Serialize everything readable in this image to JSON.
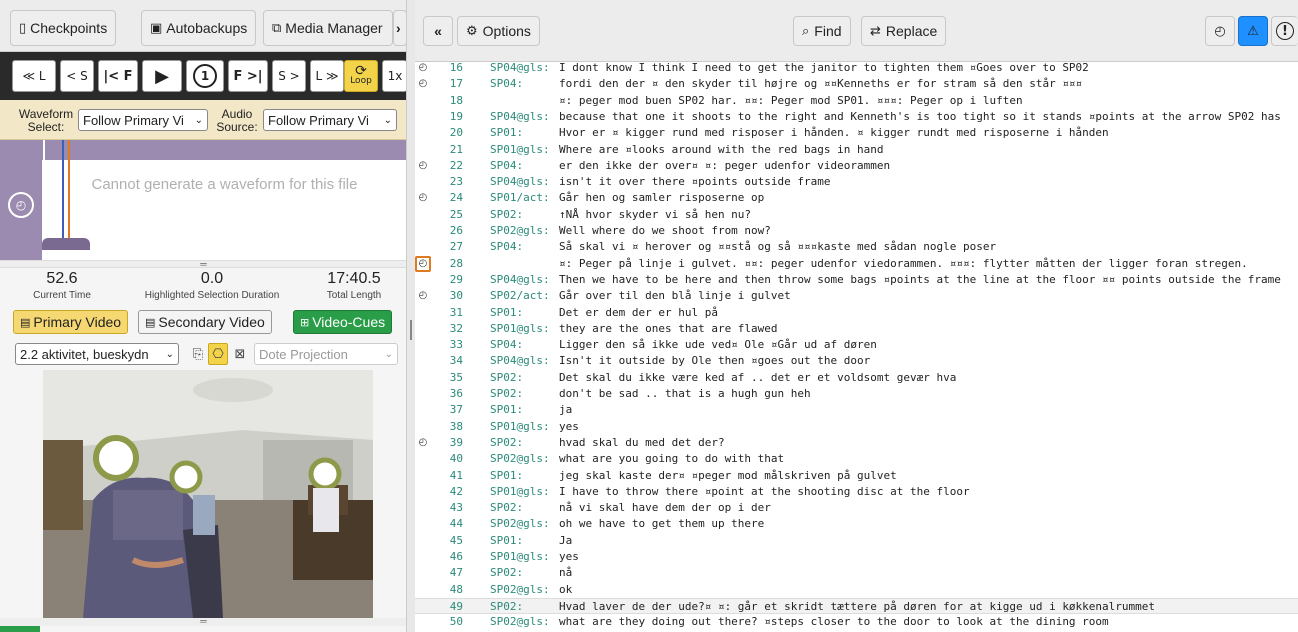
{
  "left": {
    "toolbar": {
      "checkpoints_label": "Checkpoints",
      "autobackups_label": "Autobackups",
      "media_manager_label": "Media Manager",
      "overflow_label": "›"
    },
    "controls": {
      "prev_line": "≪ L",
      "prev_segment": "< S",
      "prev_frame": "|< F",
      "play": "▶",
      "replay": "1",
      "next_frame": "F >|",
      "next_segment": "S >",
      "next_line": "L ≫",
      "loop_label": "Loop",
      "speed": "1x"
    },
    "waveform_select": {
      "waveform_label": "Waveform Select:",
      "waveform_value": "Follow Primary Vi",
      "audio_label": "Audio Source:",
      "audio_value": "Follow Primary Vi"
    },
    "waveform_message": "Cannot generate a waveform for this file",
    "stats": {
      "current_time": "52.6",
      "current_time_label": "Current Time",
      "selection_duration": "0.0",
      "selection_duration_label": "Highlighted Selection Duration",
      "total_length": "17:40.5",
      "total_length_label": "Total Length"
    },
    "video_tabs": {
      "primary": "Primary Video",
      "secondary": "Secondary Video",
      "cues": "Video-Cues"
    },
    "segment_select": {
      "value": "2.2 aktivitet, bueskydn",
      "projection_placeholder": "Dote Projection"
    }
  },
  "right": {
    "toolbar": {
      "collapse_label": "«",
      "options_label": "Options",
      "find_label": "Find",
      "replace_label": "Replace"
    },
    "colors": {
      "warning_active": "#1e90ff",
      "line_number": "#2a8a7a",
      "speaker": "#2a8a7a"
    },
    "lines": [
      {
        "n": "16",
        "spk": "SP04@gls:",
        "txt": "I dont know I think I need to get the janitor to tighten them ¤Goes over to SP02",
        "icon": "clock"
      },
      {
        "n": "17",
        "spk": "SP04:",
        "txt": "fordi den der ¤ den skyder til højre og ¤¤Kenneths er for stram så den står ¤¤¤",
        "icon": "clock"
      },
      {
        "n": "18",
        "spk": "",
        "txt": "¤: peger mod buen SP02 har. ¤¤: Peger mod SP01. ¤¤¤: Peger op i luften",
        "icon": ""
      },
      {
        "n": "19",
        "spk": "SP04@gls:",
        "txt": "because that one it shoots to the right and Kenneth's is too tight so it stands ¤points at the arrow SP02 has",
        "icon": ""
      },
      {
        "n": "20",
        "spk": "SP01:",
        "txt": "Hvor er ¤ kigger rund med risposer i hånden. ¤ kigger rundt med risposerne i hånden",
        "icon": ""
      },
      {
        "n": "21",
        "spk": "SP01@gls:",
        "txt": "Where are ¤looks around with the red bags in hand",
        "icon": ""
      },
      {
        "n": "22",
        "spk": "SP04:",
        "txt": "er den ikke der over¤ ¤: peger udenfor videorammen",
        "icon": "clock"
      },
      {
        "n": "23",
        "spk": "SP04@gls:",
        "txt": "isn't it over there ¤points outside frame",
        "icon": ""
      },
      {
        "n": "24",
        "spk": "SP01/act:",
        "txt": "Går hen og samler risposerne op",
        "icon": "clock"
      },
      {
        "n": "25",
        "spk": "SP02:",
        "txt": "↑NÅ hvor skyder vi så hen nu?",
        "icon": ""
      },
      {
        "n": "26",
        "spk": "SP02@gls:",
        "txt": "Well where do we shoot from now?",
        "icon": ""
      },
      {
        "n": "27",
        "spk": "SP04:",
        "txt": "Så skal vi ¤ herover og ¤¤stå og så ¤¤¤kaste med sådan nogle poser",
        "icon": ""
      },
      {
        "n": "28",
        "spk": "",
        "txt": "¤: Peger på linje i gulvet. ¤¤: peger udenfor viedorammen. ¤¤¤: flytter måtten der ligger foran stregen.",
        "icon": "clock-boxed"
      },
      {
        "n": "29",
        "spk": "SP04@gls:",
        "txt": "Then we have to be here and then throw some bags ¤points at the line at the floor ¤¤ points outside the frame",
        "icon": ""
      },
      {
        "n": "30",
        "spk": "SP02/act:",
        "txt": "Går over til den blå linje i gulvet",
        "icon": "clock"
      },
      {
        "n": "31",
        "spk": "SP01:",
        "txt": "Det er dem der er hul på",
        "icon": ""
      },
      {
        "n": "32",
        "spk": "SP01@gls:",
        "txt": "they are the ones that are flawed",
        "icon": ""
      },
      {
        "n": "33",
        "spk": "SP04:",
        "txt": "Ligger den så ikke ude ved¤ Ole ¤Går ud af døren",
        "icon": ""
      },
      {
        "n": "34",
        "spk": "SP04@gls:",
        "txt": "Isn't it outside by Ole then ¤goes out the door",
        "icon": ""
      },
      {
        "n": "35",
        "spk": "SP02:",
        "txt": "Det skal du ikke være ked af .. det er et voldsomt gevær hva",
        "icon": ""
      },
      {
        "n": "36",
        "spk": "SP02:",
        "txt": "don't be sad .. that is a hugh gun heh",
        "icon": ""
      },
      {
        "n": "37",
        "spk": "SP01:",
        "txt": "ja",
        "icon": ""
      },
      {
        "n": "38",
        "spk": "SP01@gls:",
        "txt": "yes",
        "icon": ""
      },
      {
        "n": "39",
        "spk": "SP02:",
        "txt": "hvad skal du med det der?",
        "icon": "clock"
      },
      {
        "n": "40",
        "spk": "SP02@gls:",
        "txt": "what are you going to do with that",
        "icon": ""
      },
      {
        "n": "41",
        "spk": "SP01:",
        "txt": "jeg skal kaste der¤ ¤peger mod målskriven på gulvet",
        "icon": ""
      },
      {
        "n": "42",
        "spk": "SP01@gls:",
        "txt": "I have to throw there ¤point at the shooting disc at the floor",
        "icon": ""
      },
      {
        "n": "43",
        "spk": "SP02:",
        "txt": "nå vi skal have dem der op i der",
        "icon": ""
      },
      {
        "n": "44",
        "spk": "SP02@gls:",
        "txt": "oh we have to get them up there",
        "icon": ""
      },
      {
        "n": "45",
        "spk": "SP01:",
        "txt": "Ja",
        "icon": ""
      },
      {
        "n": "46",
        "spk": "SP01@gls:",
        "txt": "yes",
        "icon": ""
      },
      {
        "n": "47",
        "spk": "SP02:",
        "txt": "nå",
        "icon": ""
      },
      {
        "n": "48",
        "spk": "SP02@gls:",
        "txt": "ok",
        "icon": ""
      },
      {
        "n": "49",
        "spk": "SP02:",
        "txt": "Hvad laver de der ude?¤ ¤: går et skridt tættere på døren for at kigge ud i køkkenalrummet",
        "icon": "",
        "highlight": true
      },
      {
        "n": "50",
        "spk": "SP02@gls:",
        "txt": "what are they doing out there? ¤steps closer to the door to look at the dining room",
        "icon": ""
      }
    ]
  }
}
